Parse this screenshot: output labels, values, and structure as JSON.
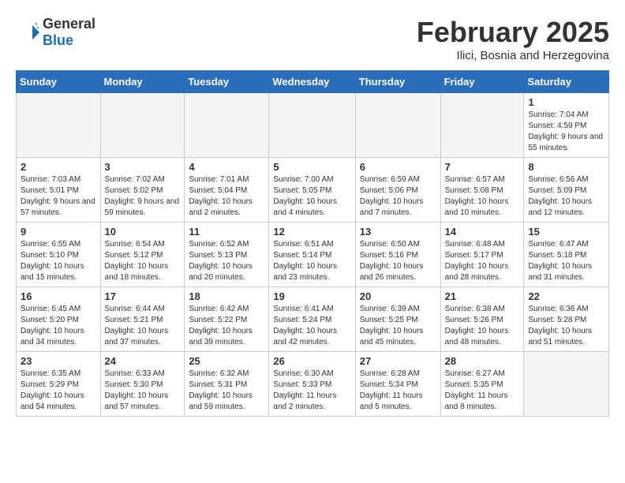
{
  "header": {
    "logo_line1": "General",
    "logo_line2": "Blue",
    "month": "February 2025",
    "location": "Ilici, Bosnia and Herzegovina"
  },
  "weekdays": [
    "Sunday",
    "Monday",
    "Tuesday",
    "Wednesday",
    "Thursday",
    "Friday",
    "Saturday"
  ],
  "weeks": [
    [
      {
        "day": "",
        "info": ""
      },
      {
        "day": "",
        "info": ""
      },
      {
        "day": "",
        "info": ""
      },
      {
        "day": "",
        "info": ""
      },
      {
        "day": "",
        "info": ""
      },
      {
        "day": "",
        "info": ""
      },
      {
        "day": "1",
        "info": "Sunrise: 7:04 AM\nSunset: 4:59 PM\nDaylight: 9 hours and 55 minutes."
      }
    ],
    [
      {
        "day": "2",
        "info": "Sunrise: 7:03 AM\nSunset: 5:01 PM\nDaylight: 9 hours and 57 minutes."
      },
      {
        "day": "3",
        "info": "Sunrise: 7:02 AM\nSunset: 5:02 PM\nDaylight: 9 hours and 59 minutes."
      },
      {
        "day": "4",
        "info": "Sunrise: 7:01 AM\nSunset: 5:04 PM\nDaylight: 10 hours and 2 minutes."
      },
      {
        "day": "5",
        "info": "Sunrise: 7:00 AM\nSunset: 5:05 PM\nDaylight: 10 hours and 4 minutes."
      },
      {
        "day": "6",
        "info": "Sunrise: 6:59 AM\nSunset: 5:06 PM\nDaylight: 10 hours and 7 minutes."
      },
      {
        "day": "7",
        "info": "Sunrise: 6:57 AM\nSunset: 5:08 PM\nDaylight: 10 hours and 10 minutes."
      },
      {
        "day": "8",
        "info": "Sunrise: 6:56 AM\nSunset: 5:09 PM\nDaylight: 10 hours and 12 minutes."
      }
    ],
    [
      {
        "day": "9",
        "info": "Sunrise: 6:55 AM\nSunset: 5:10 PM\nDaylight: 10 hours and 15 minutes."
      },
      {
        "day": "10",
        "info": "Sunrise: 6:54 AM\nSunset: 5:12 PM\nDaylight: 10 hours and 18 minutes."
      },
      {
        "day": "11",
        "info": "Sunrise: 6:52 AM\nSunset: 5:13 PM\nDaylight: 10 hours and 20 minutes."
      },
      {
        "day": "12",
        "info": "Sunrise: 6:51 AM\nSunset: 5:14 PM\nDaylight: 10 hours and 23 minutes."
      },
      {
        "day": "13",
        "info": "Sunrise: 6:50 AM\nSunset: 5:16 PM\nDaylight: 10 hours and 26 minutes."
      },
      {
        "day": "14",
        "info": "Sunrise: 6:48 AM\nSunset: 5:17 PM\nDaylight: 10 hours and 28 minutes."
      },
      {
        "day": "15",
        "info": "Sunrise: 6:47 AM\nSunset: 5:18 PM\nDaylight: 10 hours and 31 minutes."
      }
    ],
    [
      {
        "day": "16",
        "info": "Sunrise: 6:45 AM\nSunset: 5:20 PM\nDaylight: 10 hours and 34 minutes."
      },
      {
        "day": "17",
        "info": "Sunrise: 6:44 AM\nSunset: 5:21 PM\nDaylight: 10 hours and 37 minutes."
      },
      {
        "day": "18",
        "info": "Sunrise: 6:42 AM\nSunset: 5:22 PM\nDaylight: 10 hours and 39 minutes."
      },
      {
        "day": "19",
        "info": "Sunrise: 6:41 AM\nSunset: 5:24 PM\nDaylight: 10 hours and 42 minutes."
      },
      {
        "day": "20",
        "info": "Sunrise: 6:39 AM\nSunset: 5:25 PM\nDaylight: 10 hours and 45 minutes."
      },
      {
        "day": "21",
        "info": "Sunrise: 6:38 AM\nSunset: 5:26 PM\nDaylight: 10 hours and 48 minutes."
      },
      {
        "day": "22",
        "info": "Sunrise: 6:36 AM\nSunset: 5:28 PM\nDaylight: 10 hours and 51 minutes."
      }
    ],
    [
      {
        "day": "23",
        "info": "Sunrise: 6:35 AM\nSunset: 5:29 PM\nDaylight: 10 hours and 54 minutes."
      },
      {
        "day": "24",
        "info": "Sunrise: 6:33 AM\nSunset: 5:30 PM\nDaylight: 10 hours and 57 minutes."
      },
      {
        "day": "25",
        "info": "Sunrise: 6:32 AM\nSunset: 5:31 PM\nDaylight: 10 hours and 59 minutes."
      },
      {
        "day": "26",
        "info": "Sunrise: 6:30 AM\nSunset: 5:33 PM\nDaylight: 11 hours and 2 minutes."
      },
      {
        "day": "27",
        "info": "Sunrise: 6:28 AM\nSunset: 5:34 PM\nDaylight: 11 hours and 5 minutes."
      },
      {
        "day": "28",
        "info": "Sunrise: 6:27 AM\nSunset: 5:35 PM\nDaylight: 11 hours and 8 minutes."
      },
      {
        "day": "",
        "info": ""
      }
    ]
  ]
}
